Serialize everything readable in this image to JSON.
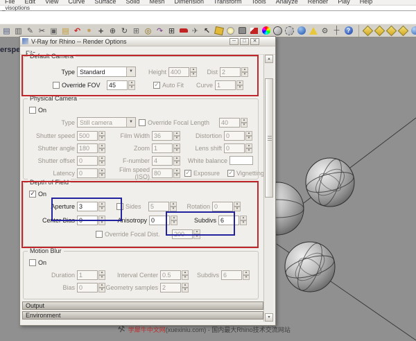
{
  "menu_bar": {
    "items": [
      "File",
      "Edit",
      "View",
      "Curve",
      "Surface",
      "Solid",
      "Mesh",
      "Dimension",
      "Transform",
      "Tools",
      "Analyze",
      "Render",
      "Play",
      "Help"
    ]
  },
  "command": {
    "history": "_visoptions"
  },
  "toolbar": {
    "main": [
      "save",
      "print",
      "properties",
      "cut",
      "copy",
      "paste",
      "undo",
      "pan",
      "move",
      "zoom",
      "rotate-view",
      "zoom-window",
      "zoom-extents",
      "undo-view",
      "viewport-layout",
      "car",
      "plane",
      "select",
      "paint-bucket",
      "lightbulb",
      "lock",
      "vray-material",
      "color-wheel",
      "render-sphere",
      "render-region",
      "globe",
      "vray-options",
      "gear",
      "dimension",
      "help"
    ],
    "right": [
      "diamond-1",
      "diamond-2",
      "diamond-3",
      "diamond-4",
      "sphere"
    ],
    "sub": [
      "notes"
    ]
  },
  "viewport": {
    "label": "erspe"
  },
  "watermark": {
    "brand": "学犀牛中文网",
    "rest": "(xuexiniu.com) - 国内最大Rhino技术交流网站"
  },
  "dialog": {
    "title": "V-Ray for Rhino -- Render Options",
    "menu_file": "File",
    "window_buttons": {
      "minimize": "─",
      "maximize": "□",
      "close": "✕"
    },
    "default_camera": {
      "title": "Default Camera",
      "type_label": "Type",
      "type_value": "Standard",
      "height_label": "Height",
      "height_value": "400",
      "dist_label": "Dist",
      "dist_value": "2",
      "override_fov_label": "Override FOV",
      "override_fov_value": "45",
      "auto_fit_label": "Auto Fit",
      "curve_label": "Curve",
      "curve_value": "1"
    },
    "physical_camera": {
      "title": "Physical Camera",
      "on_label": "On",
      "type_label": "Type",
      "type_value": "Still camera",
      "override_focal_label": "Override Focal Length",
      "focal_value": "40",
      "shutter_speed_label": "Shutter speed",
      "shutter_speed_value": "500",
      "film_width_label": "Film Width",
      "film_width_value": "36",
      "distortion_label": "Distortion",
      "distortion_value": "0",
      "shutter_angle_label": "Shutter angle",
      "shutter_angle_value": "180",
      "zoom_label": "Zoom",
      "zoom_value": "1",
      "lens_shift_label": "Lens shift",
      "lens_shift_value": "0",
      "shutter_offset_label": "Shutter offset",
      "shutter_offset_value": "0",
      "f_number_label": "F-number",
      "f_number_value": "4",
      "white_balance_label": "White balance",
      "latency_label": "Latency",
      "latency_value": "0",
      "film_speed_label": "Film speed (ISO)",
      "film_speed_value": "80",
      "exposure_label": "Exposure",
      "vignetting_label": "Vignetting"
    },
    "depth_of_field": {
      "title": "Depth of Field",
      "on_label": "On",
      "aperture_label": "Aperture",
      "aperture_value": "3",
      "sides_label": "Sides",
      "sides_value": "5",
      "rotation_label": "Rotation",
      "rotation_value": "0",
      "center_bias_label": "Center Bias",
      "center_bias_value": "0",
      "anisotropy_label": "Anisotropy",
      "anisotropy_value": "0",
      "subdivs_label": "Subdivs",
      "subdivs_value": "6",
      "override_focal_dist_label": "Override Focal Dist.",
      "focal_dist_value": "200"
    },
    "motion_blur": {
      "title": "Motion Blur",
      "on_label": "On",
      "duration_label": "Duration",
      "duration_value": "1",
      "interval_center_label": "Interval Center",
      "interval_center_value": "0.5",
      "subdivs_label": "Subdivs",
      "subdivs_value": "6",
      "bias_label": "Bias",
      "bias_value": "0",
      "geometry_samples_label": "Geometry samples",
      "geometry_samples_value": "2"
    },
    "rollups": {
      "output": "Output",
      "environment": "Environment"
    }
  },
  "colors": {
    "highlight_red": "#c0272d",
    "highlight_blue": "#22229e",
    "viewport_gray": "#909090"
  }
}
